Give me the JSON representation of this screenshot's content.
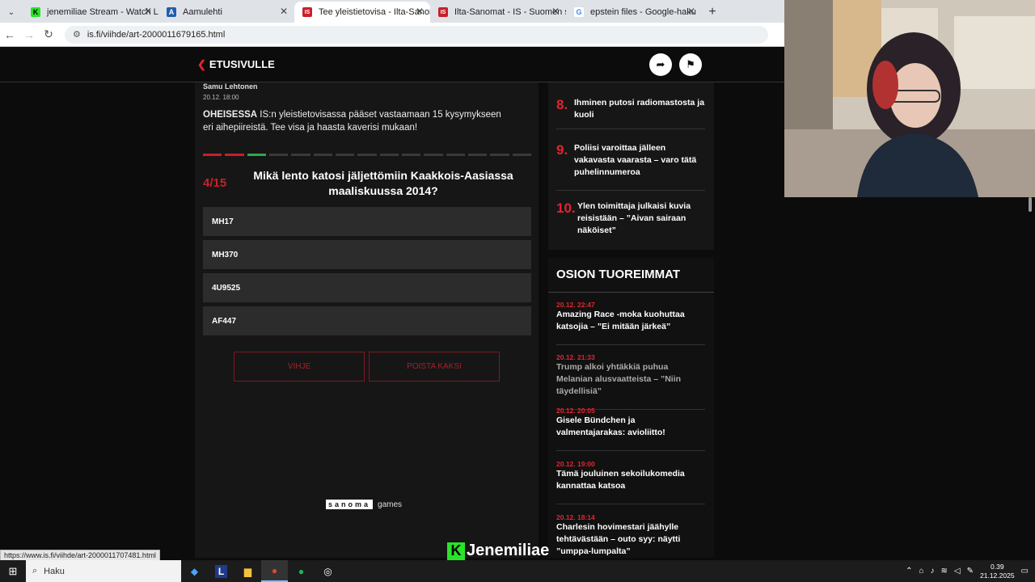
{
  "browser": {
    "tabs": [
      {
        "title": "jenemiliae Stream - Watch Live",
        "fav": "K",
        "fav_color": "#29e32a",
        "active": false
      },
      {
        "title": "Aamulehti",
        "fav": "A",
        "fav_color": "#1f5fae",
        "active": false
      },
      {
        "title": "Tee yleistietovisa - Ilta-Sanomat",
        "fav": "IS",
        "fav_color": "#c8202a",
        "active": true
      },
      {
        "title": "Ilta-Sanomat - IS - Suomen suu",
        "fav": "IS",
        "fav_color": "#c8202a",
        "active": false
      },
      {
        "title": "epstein files - Google-haku",
        "fav": "G",
        "fav_color": "#4285f4",
        "active": false
      }
    ],
    "url": "is.fi/viihde/art-2000011679165.html",
    "status_url": "https://www.is.fi/viihde/art-2000011707481.html"
  },
  "topnav": {
    "back_label": "ETUSIVULLE"
  },
  "article": {
    "author": "Samu Lehtonen",
    "date": "20.12. 18:00",
    "lead_bold": "OHEISESSA",
    "lead_rest": " IS:n yleistietovisassa pääset vastaamaan 15 kysymykseen eri aihepiireistä. Tee visa ja haasta kaverisi mukaan!",
    "progress": {
      "current": 4,
      "total": 15,
      "answered": [
        "wrong",
        "wrong",
        "correct"
      ]
    },
    "question_number": "4/15",
    "question": "Mikä lento katosi jäljettömiin Kaakkois-Aasiassa maaliskuussa 2014?",
    "options": [
      "MH17",
      "MH370",
      "4U9525",
      "AF447"
    ],
    "hint_button": "VIHJE",
    "remove_two_button": "POISTA KAKSI",
    "brand_box": "sanoma",
    "brand_text": "games"
  },
  "most_read": [
    {
      "num": "8.",
      "title": "Ihminen putosi radiomastosta ja kuoli"
    },
    {
      "num": "9.",
      "title": "Poliisi varoittaa jälleen vakavasta vaarasta – varo tätä puhelin­numeroa"
    },
    {
      "num": "10.",
      "title": "Ylen toimittaja julkaisi kuvia reisistään – ”Aivan sairaan näköiset”"
    }
  ],
  "latest": {
    "heading": "OSION TUOREIMMAT",
    "items": [
      {
        "time": "20.12. 22:47",
        "title": "Amazing Race -moka kuohuttaa katsojia – ”Ei mitään järkeä”"
      },
      {
        "time": "20.12. 21:33",
        "title": "Trump alkoi yhtäkkiä puhua Melanian alusvaatteista – ”Niin täydellisiä”"
      },
      {
        "time": "20.12. 20:05",
        "title": "Gisele Bündchen ja valmentajarakas: avioliitto!"
      },
      {
        "time": "20.12. 19:00",
        "title": "Tämä jouluinen sekoilukomedia kannattaa katsoa"
      },
      {
        "time": "20.12. 18:14",
        "title": "Charlesin hovimestari jäähylle tehtävästään – outo syy: näytti ”umppa-lumpalta”"
      }
    ]
  },
  "stream_overlay": {
    "logo": "K",
    "name": "Jenemiliae"
  },
  "taskbar": {
    "search_placeholder": "Haku",
    "time": "0.39",
    "date": "21.12.2025"
  }
}
